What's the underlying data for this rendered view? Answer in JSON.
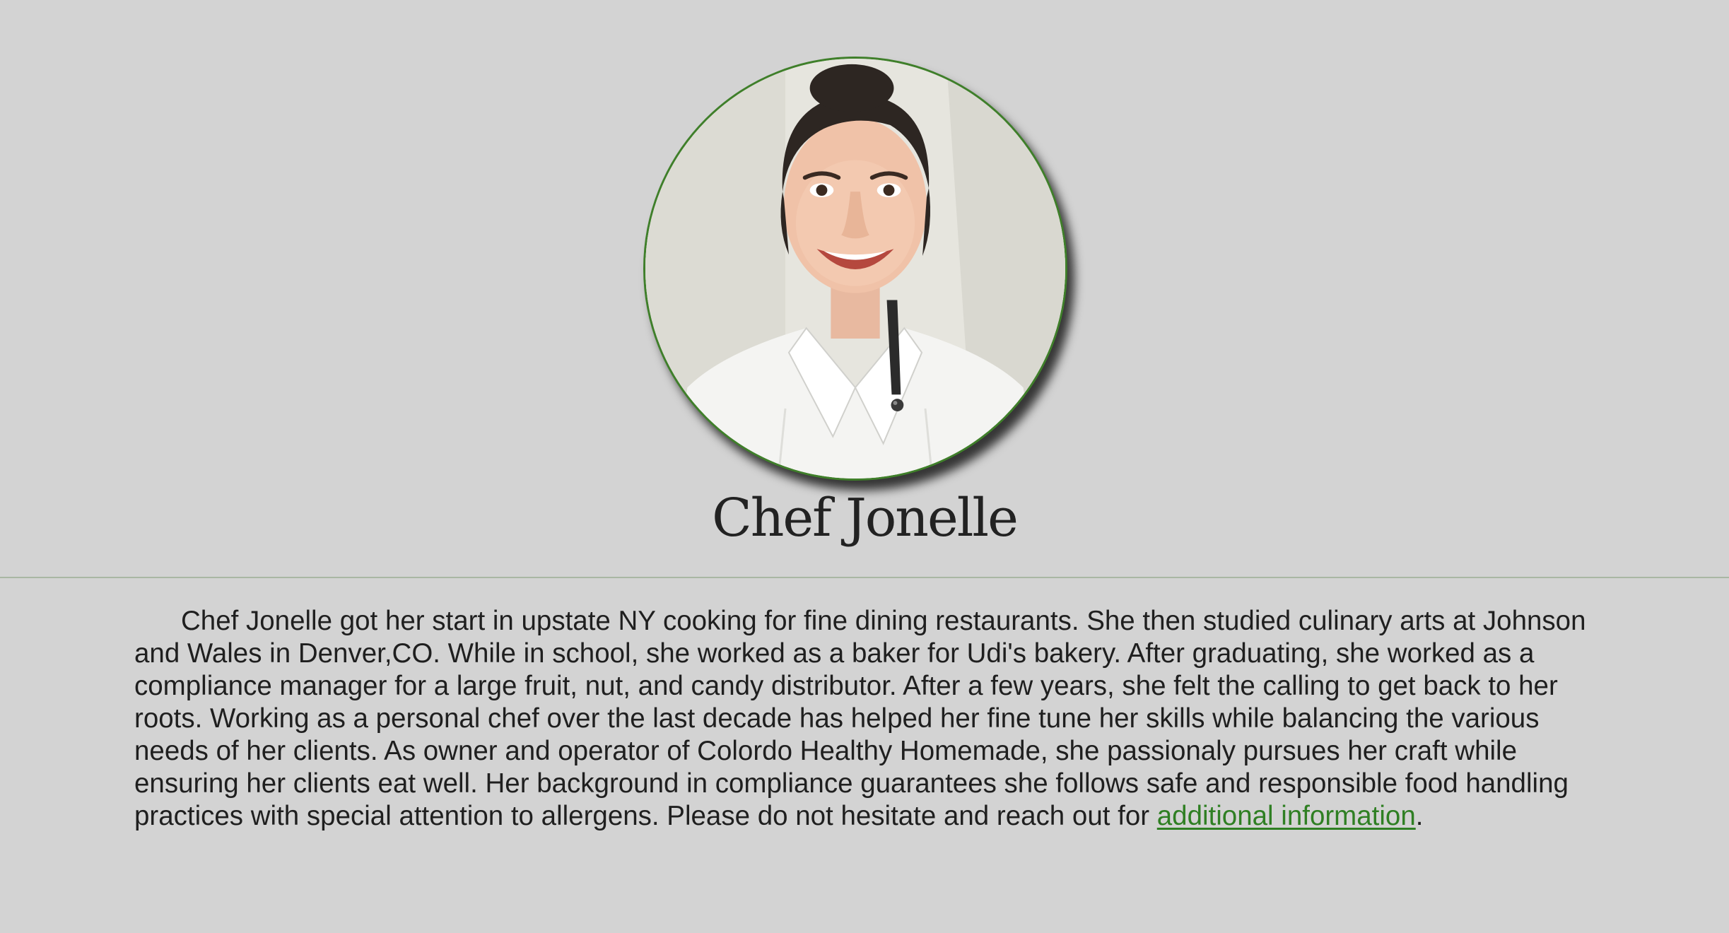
{
  "profile": {
    "name": "Chef Jonelle",
    "photo_alt": "Chef Jonelle",
    "bio_text": "Chef Jonelle got her start in upstate NY cooking for fine dining restaurants. She then studied culinary arts at Johnson and Wales in Denver,CO. While in school, she worked as a baker for Udi's bakery. After graduating, she worked as a compliance manager for a large fruit, nut, and candy distributor. After a few years, she felt the calling to get back to her roots. Working as a personal chef over the last decade has helped her fine tune her skills while balancing the various needs of her clients. As owner and operator of Colordo Healthy Homemade, she passionaly pursues her craft while ensuring her clients eat well. Her background in compliance guarantees she follows safe and responsible food handling practices with special attention to allergens. Please do not hesitate and reach out for ",
    "link_text": "additional information",
    "trailing_text": "."
  },
  "colors": {
    "background": "#d3d3d3",
    "accent_green": "#2f7f23",
    "frame_border": "#3f7f2a",
    "text": "#1f1f1f"
  }
}
